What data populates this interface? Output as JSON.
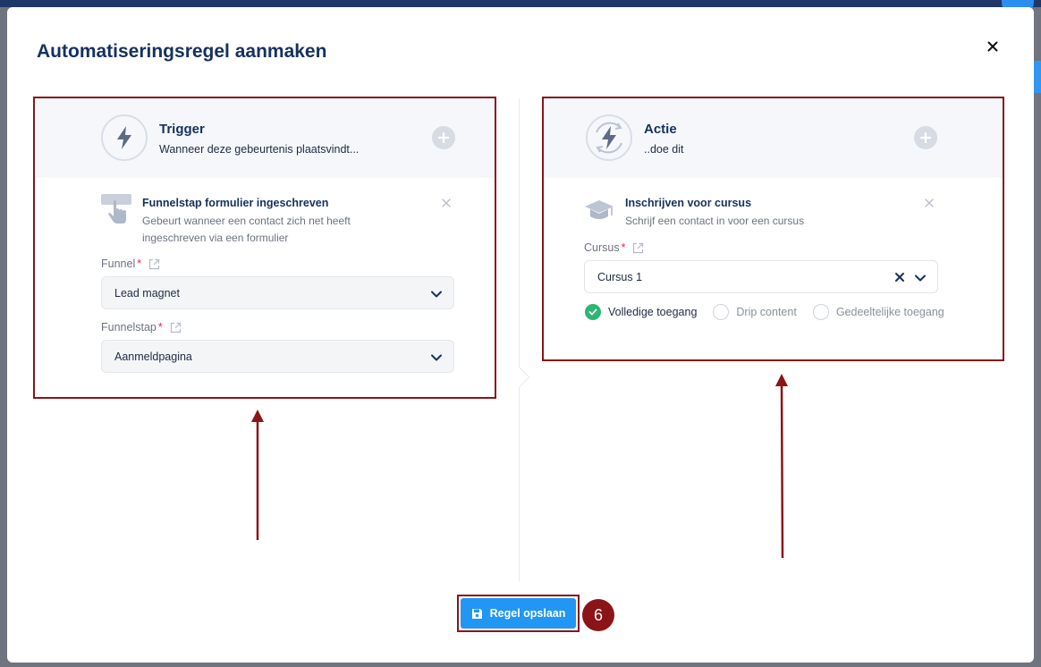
{
  "modal": {
    "title": "Automatiseringsregel aanmaken",
    "close_icon": "close-icon"
  },
  "trigger": {
    "title": "Trigger",
    "subtitle": "Wanneer deze gebeurtenis plaatsvindt...",
    "icon": "lightning-icon",
    "item": {
      "title": "Funnelstap formulier ingeschreven",
      "description_line1": "Gebeurt wanneer een contact zich net heeft",
      "description_line2": "ingeschreven via een formulier",
      "icon": "hand-pointer-icon"
    },
    "funnel": {
      "label": "Funnel",
      "required_mark": "*",
      "value": "Lead magnet"
    },
    "funnelstep": {
      "label": "Funnelstap",
      "required_mark": "*",
      "value": "Aanmeldpagina"
    }
  },
  "action": {
    "title": "Actie",
    "subtitle": "..doe dit",
    "icon": "lightning-cycle-icon",
    "item": {
      "title": "Inschrijven voor cursus",
      "description": "Schrijf een contact in voor een cursus",
      "icon": "graduation-cap-icon"
    },
    "course": {
      "label": "Cursus",
      "required_mark": "*",
      "value": "Cursus 1"
    },
    "access_options": [
      {
        "label": "Volledige toegang",
        "checked": true
      },
      {
        "label": "Drip content",
        "checked": false
      },
      {
        "label": "Gedeeltelijke toegang",
        "checked": false
      }
    ]
  },
  "footer": {
    "save_label": "Regel opslaan",
    "step_number": "6"
  },
  "colors": {
    "primary": "#2196f3",
    "navy": "#16315f",
    "annotation": "#8b1418",
    "success": "#2bb673"
  }
}
